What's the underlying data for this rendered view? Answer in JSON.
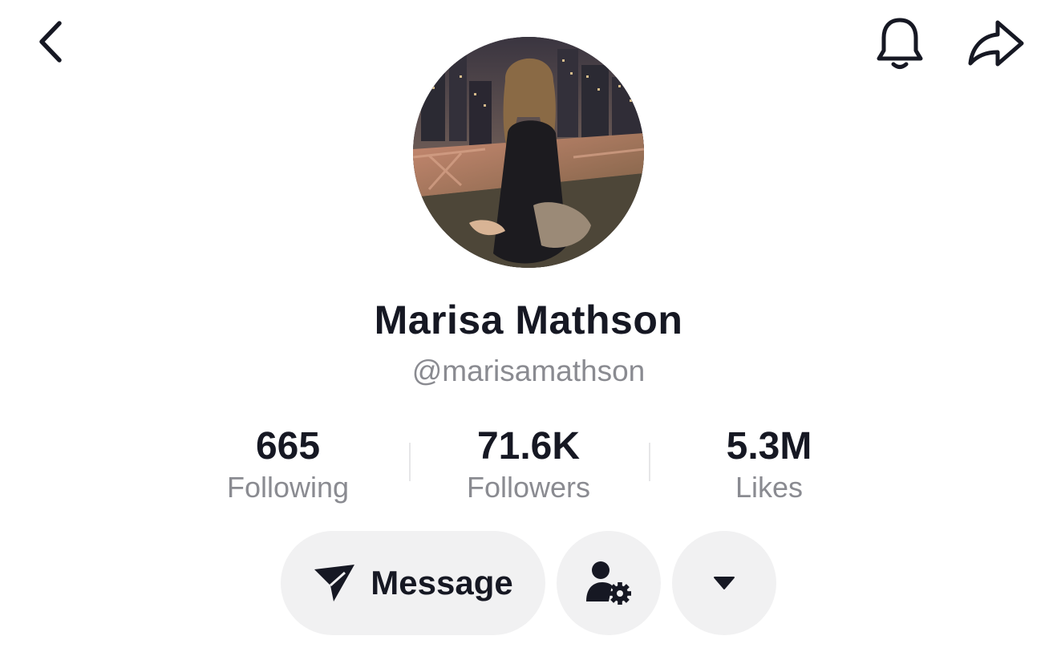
{
  "header": {
    "back_icon": "chevron-left-icon",
    "notification_icon": "bell-icon",
    "share_icon": "share-arrow-icon"
  },
  "profile": {
    "avatar": "profile-photo",
    "display_name": "Marisa Mathson",
    "username": "@marisamathson"
  },
  "stats": [
    {
      "value": "665",
      "label": "Following"
    },
    {
      "value": "71.6K",
      "label": "Followers"
    },
    {
      "value": "5.3M",
      "label": "Likes"
    }
  ],
  "actions": {
    "message_label": "Message",
    "message_icon": "send-arrow-icon",
    "friend_settings_icon": "user-gear-icon",
    "more_icon": "caret-down-icon"
  },
  "colors": {
    "text_primary": "#161823",
    "text_secondary": "#8a8b91",
    "button_bg": "#f1f1f2"
  }
}
